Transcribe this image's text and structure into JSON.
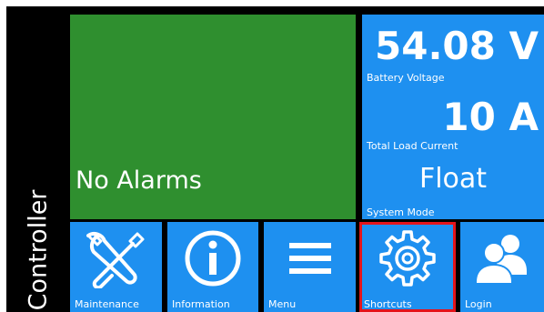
{
  "controller": {
    "side_label": "Controller"
  },
  "alarm_tile": {
    "text": "No Alarms",
    "color": "#2f8f2f"
  },
  "status_tile": {
    "color": "#1e90f0",
    "battery_voltage": {
      "value": "54.08 V",
      "label": "Battery Voltage"
    },
    "total_load_current": {
      "value": "10 A",
      "label": "Total Load Current"
    },
    "system_mode": {
      "value": "Float",
      "label": "System Mode"
    }
  },
  "buttons": [
    {
      "label": "Maintenance",
      "icon": "wrench-screwdriver-icon"
    },
    {
      "label": "Information",
      "icon": "info-icon"
    },
    {
      "label": "Menu",
      "icon": "hamburger-menu-icon"
    },
    {
      "label": "Shortcuts",
      "icon": "gear-icon",
      "highlighted": true,
      "highlight_color": "#e4141b"
    },
    {
      "label": "Login",
      "icon": "users-icon"
    }
  ]
}
